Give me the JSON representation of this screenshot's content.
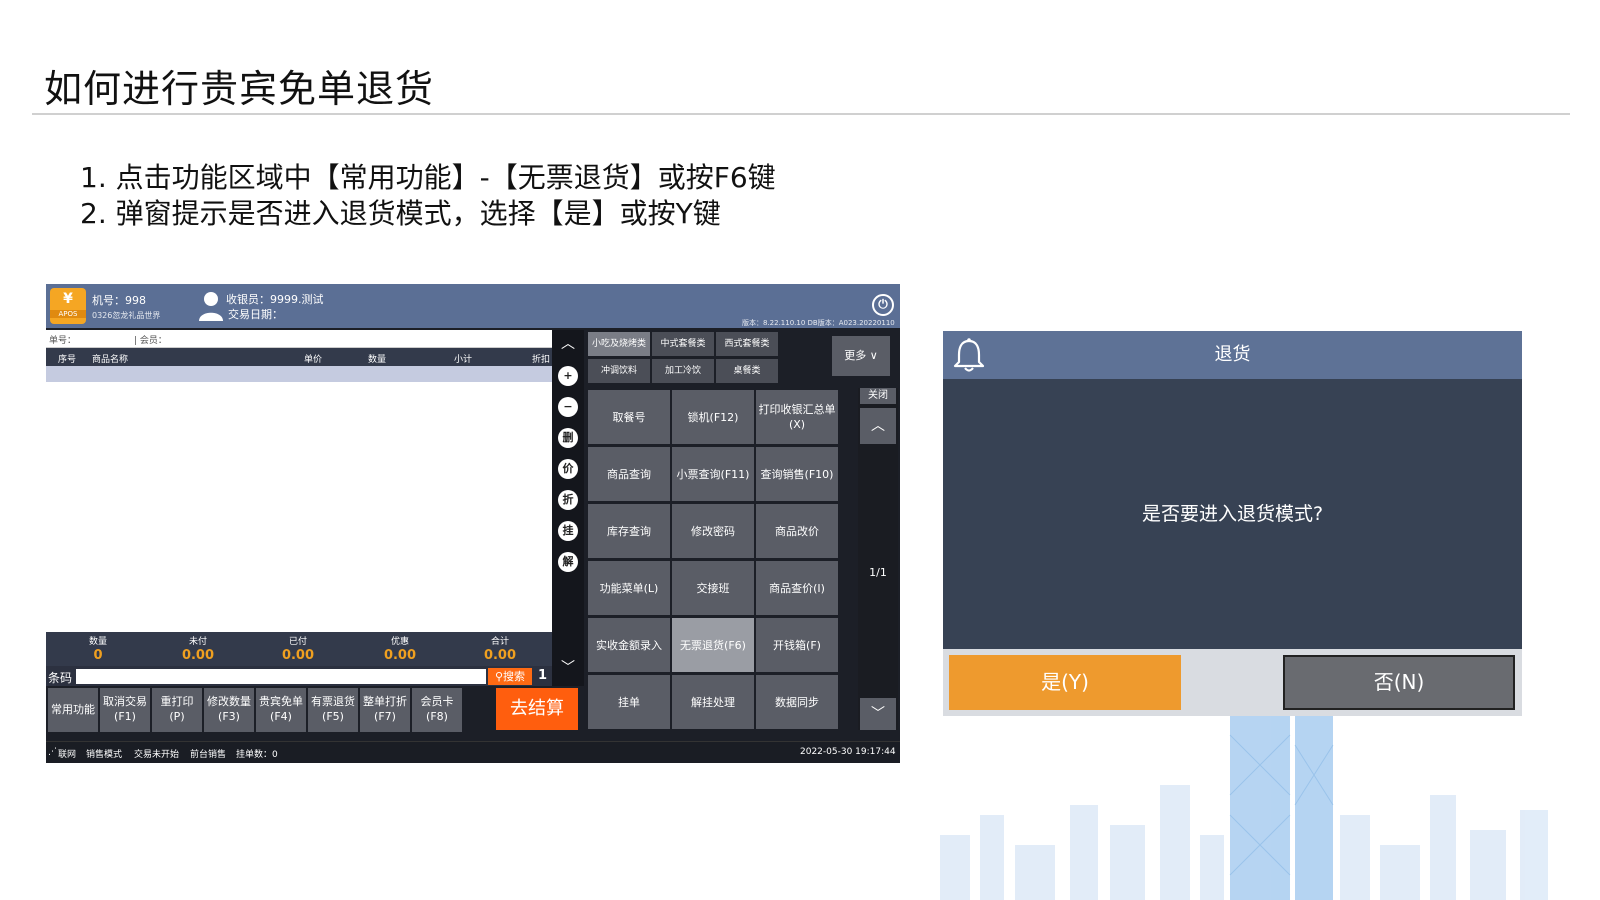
{
  "slide": {
    "title": "如何进行贵宾免单退货",
    "steps": [
      "1.  点击功能区域中【常用功能】-【无票退货】或按F6键",
      "2.  弹窗提示是否进入退货模式，选择【是】或按Y键"
    ]
  },
  "pos": {
    "logo_text": "APOS",
    "logo_symbol": "¥",
    "machine_no": "机号：998",
    "store": "0326忽龙礼品世界",
    "cashier": "收银员：9999.测试",
    "trade_date": "交易日期：",
    "version": "版本：8.22.110.10 DB版本：A023.20220110",
    "cart_header_left": "单号：",
    "cart_header_member": "| 会员：",
    "columns": [
      "序号",
      "商品名称",
      "单价",
      "数量",
      "小计",
      "折扣"
    ],
    "totals": [
      {
        "label": "数量",
        "value": "0"
      },
      {
        "label": "未付",
        "value": "0.00"
      },
      {
        "label": "已付",
        "value": "0.00"
      },
      {
        "label": "优惠",
        "value": "0.00"
      },
      {
        "label": "合计",
        "value": "0.00"
      }
    ],
    "barcode_label": "条码",
    "search_label": "搜索",
    "qty_value": "1",
    "function_keys": [
      [
        "常用功能",
        ""
      ],
      [
        "取消交易",
        "(F1)"
      ],
      [
        "重打印",
        "(P)"
      ],
      [
        "修改数量",
        "(F3)"
      ],
      [
        "贵宾免单",
        "(F4)"
      ],
      [
        "有票退货",
        "(F5)"
      ],
      [
        "整单打折",
        "(F7)"
      ],
      [
        "会员卡",
        "(F8)"
      ]
    ],
    "checkout_label": "去结算",
    "side_buttons": [
      "+",
      "−",
      "删",
      "价",
      "折",
      "挂",
      "解"
    ],
    "categories": [
      "小吃及烧烤类",
      "中式套餐类",
      "西式套餐类",
      "冲调饮料",
      "加工冷饮",
      "桌餐类"
    ],
    "more_label": "更多",
    "close_label": "关闭",
    "page_indicator": "1/1",
    "grid": [
      "取餐号",
      "锁机(F12)",
      "打印收银汇总单(X)",
      "商品查询",
      "小票查询(F11)",
      "查询销售(F10)",
      "库存查询",
      "修改密码",
      "商品改价",
      "功能菜单(L)",
      "交接班",
      "商品查价(I)",
      "实收金额录入",
      "无票退货(F6)",
      "开钱箱(F)",
      "挂单",
      "解挂处理",
      "数据同步"
    ],
    "status_items": [
      "联网",
      "销售模式",
      "交易未开始",
      "前台销售",
      "挂单数：0"
    ],
    "datetime": "2022-05-30 19:17:44"
  },
  "dialog": {
    "title": "退货",
    "message": "是否要进入退货模式?",
    "yes_label": "是(Y)",
    "no_label": "否(N)"
  }
}
